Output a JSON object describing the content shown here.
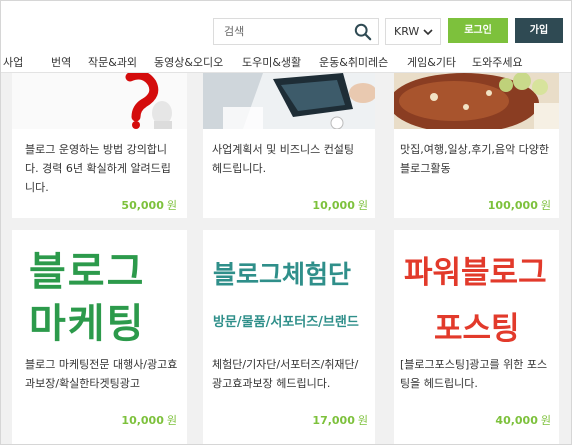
{
  "header": {
    "search_placeholder": "검색",
    "currency": "KRW",
    "login_label": "로그인",
    "join_label": "가입"
  },
  "nav": {
    "items": [
      "사업",
      "번역",
      "작문&과외",
      "동영상&오디오",
      "도우미&생활",
      "운동&취미레슨",
      "게임&기타",
      "도와주세요"
    ]
  },
  "cards": [
    {
      "desc": "블로그 운영하는 방법 강의합니다. 경력 6년 확실하게 알려드립니다.",
      "price": "50,000",
      "unit": "원"
    },
    {
      "desc": "사업계획서 및 비즈니스 컨설팅 헤드립니다.",
      "price": "10,000",
      "unit": "원"
    },
    {
      "desc": "맛집,여행,일상,후기,음악 다양한블로그활동",
      "price": "100,000",
      "unit": "원"
    },
    {
      "desc": "블로그 마케팅전문 대행사/광고효과보장/확실한타겟팅광고",
      "price": "10,000",
      "unit": "원",
      "img_line1": "블로그",
      "img_line2": "마케팅"
    },
    {
      "desc": "체험단/기자단/서포터즈/취재단/ 광고효과보장 헤드립니다.",
      "price": "17,000",
      "unit": "원",
      "img_line1": "블로그체험단",
      "img_line2": "방문/물품/서포터즈/브랜드"
    },
    {
      "desc": "[블로그포스팅]광고를 위한 포스팅을 헤드립니다.",
      "price": "40,000",
      "unit": "원",
      "img_line1": "파워블로그",
      "img_line2": "포스팅"
    }
  ],
  "colors": {
    "accent_green": "#7dc13c",
    "dark_button": "#2f4a53"
  }
}
